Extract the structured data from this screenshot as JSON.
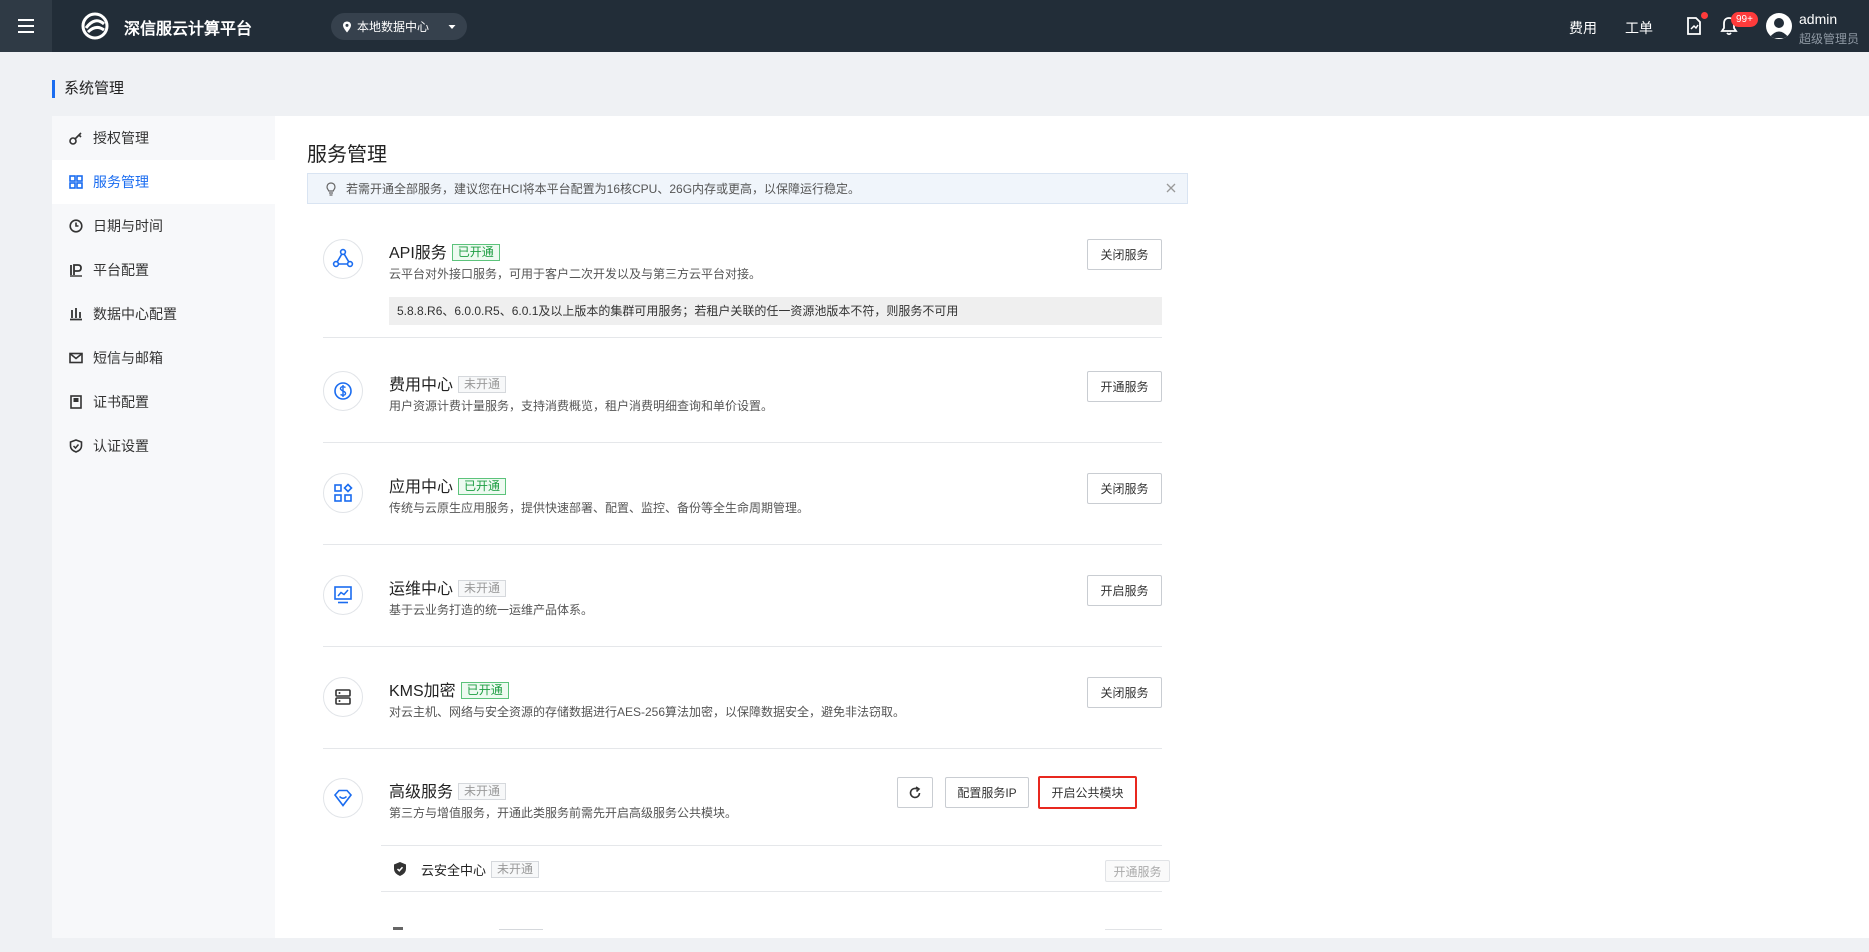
{
  "topbar": {
    "brand": "深信服云计算平台",
    "datacenter": "本地数据中心",
    "links": [
      "费用",
      "工单"
    ],
    "badge": "99+",
    "user_name": "admin",
    "user_role": "超级管理员"
  },
  "page": {
    "title": "系统管理"
  },
  "sidebar": {
    "items": [
      {
        "label": "授权管理",
        "icon": "key-icon"
      },
      {
        "label": "服务管理",
        "icon": "grid-icon",
        "active": true
      },
      {
        "label": "日期与时间",
        "icon": "clock-icon"
      },
      {
        "label": "平台配置",
        "icon": "ip-icon"
      },
      {
        "label": "数据中心配置",
        "icon": "bar-chart-icon"
      },
      {
        "label": "短信与邮箱",
        "icon": "mail-icon"
      },
      {
        "label": "证书配置",
        "icon": "certificate-icon"
      },
      {
        "label": "认证设置",
        "icon": "shield-icon"
      }
    ]
  },
  "main": {
    "title": "服务管理",
    "tip": "若需开通全部服务，建议您在HCI将本平台配置为16核CPU、26G内存或更高，以保障运行稳定。",
    "services": [
      {
        "name": "API服务",
        "status": "已开通",
        "desc": "云平台对外接口服务，可用于客户二次开发以及与第三方云平台对接。",
        "note": "5.8.8.R6、6.0.0.R5、6.0.1及以上版本的集群可用服务；若租户关联的任一资源池版本不符，则服务不可用",
        "action": "关闭服务"
      },
      {
        "name": "费用中心",
        "status": "未开通",
        "desc": "用户资源计费计量服务，支持消费概览，租户消费明细查询和单价设置。",
        "action": "开通服务"
      },
      {
        "name": "应用中心",
        "status": "已开通",
        "desc": "传统与云原生应用服务，提供快速部署、配置、监控、备份等全生命周期管理。",
        "action": "关闭服务"
      },
      {
        "name": "运维中心",
        "status": "未开通",
        "desc": "基于云业务打造的统一运维产品体系。",
        "action": "开启服务"
      },
      {
        "name": "KMS加密",
        "status": "已开通",
        "desc": "对云主机、网络与安全资源的存储数据进行AES-256算法加密，以保障数据安全，避免非法窃取。",
        "action": "关闭服务"
      },
      {
        "name": "高级服务",
        "status": "未开通",
        "desc": "第三方与增值服务，开通此类服务前需先开启高级服务公共模块。",
        "action_ip": "配置服务IP",
        "action": "开启公共模块"
      }
    ],
    "sub_services": [
      {
        "name": "云安全中心",
        "status": "未开通",
        "action": "开通服务"
      }
    ]
  }
}
